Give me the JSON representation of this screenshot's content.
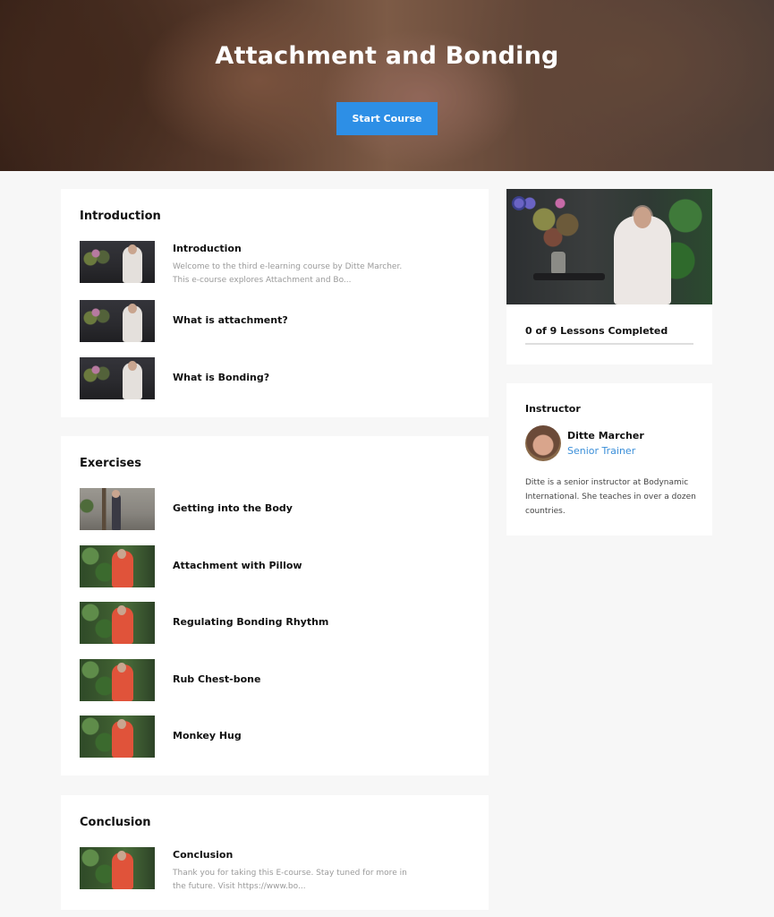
{
  "hero": {
    "title": "Attachment and Bonding",
    "cta_label": "Start Course"
  },
  "sections": [
    {
      "title": "Introduction",
      "lessons": [
        {
          "title": "Introduction",
          "description": "Welcome to the third e-learning course by Ditte Marcher. This e-course explores Attachment and Bo...",
          "thumb": "dark"
        },
        {
          "title": "What is attachment?",
          "thumb": "dark"
        },
        {
          "title": "What is Bonding?",
          "thumb": "dark"
        }
      ]
    },
    {
      "title": "Exercises",
      "lessons": [
        {
          "title": "Getting into the Body",
          "thumb": "room"
        },
        {
          "title": "Attachment with Pillow",
          "thumb": "green"
        },
        {
          "title": "Regulating Bonding Rhythm",
          "thumb": "green"
        },
        {
          "title": "Rub Chest-bone",
          "thumb": "green"
        },
        {
          "title": "Monkey Hug",
          "thumb": "green"
        }
      ]
    },
    {
      "title": "Conclusion",
      "lessons": [
        {
          "title": "Conclusion",
          "description": "Thank you for taking this E-course. Stay tuned for more in the future. Visit https://www.bo...",
          "thumb": "green"
        }
      ]
    }
  ],
  "progress": {
    "label": "0 of 9 Lessons Completed",
    "completed": 0,
    "total": 9
  },
  "instructor": {
    "heading": "Instructor",
    "name": "Ditte Marcher",
    "role": "Senior Trainer",
    "bio": "Ditte is a senior instructor at Bodynamic International. She teaches in over a dozen countries."
  },
  "colors": {
    "accent": "#2d8fe6",
    "link": "#3b8fd9"
  }
}
